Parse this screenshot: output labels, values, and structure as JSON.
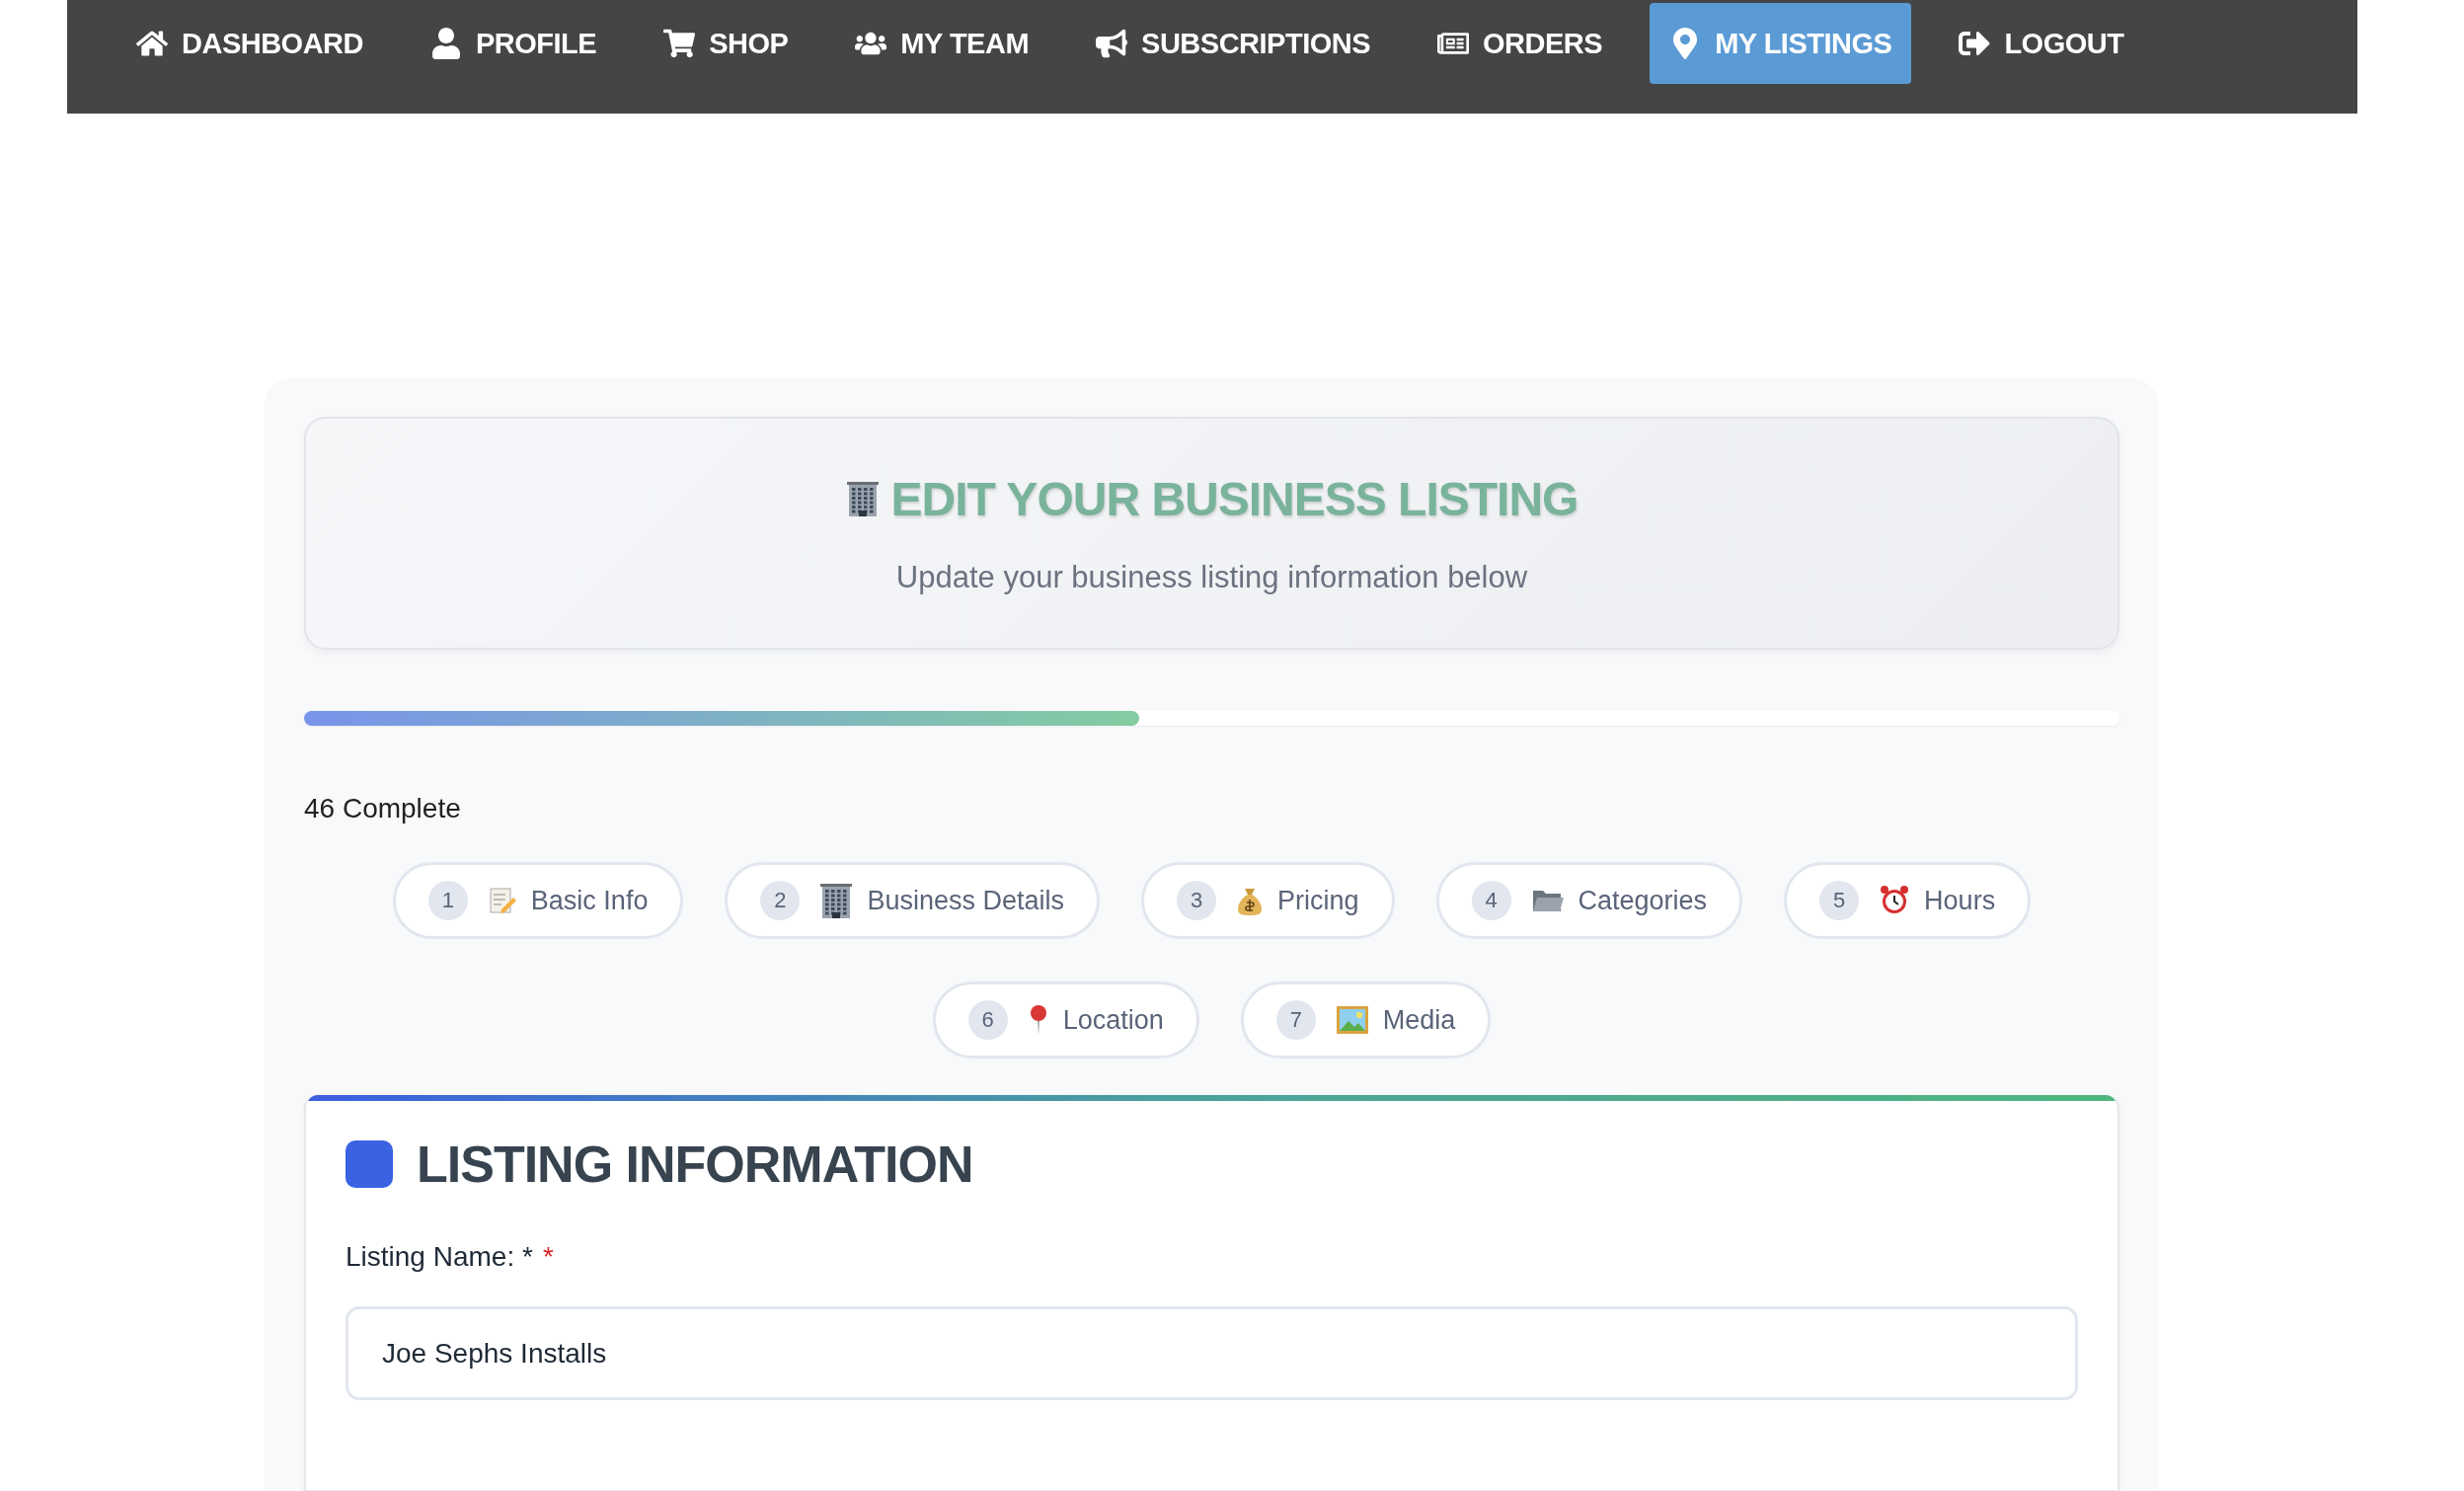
{
  "nav": {
    "items": [
      {
        "label": "DASHBOARD",
        "selected": false
      },
      {
        "label": "PROFILE",
        "selected": false
      },
      {
        "label": "SHOP",
        "selected": false
      },
      {
        "label": "MY TEAM",
        "selected": false
      },
      {
        "label": "SUBSCRIPTIONS",
        "selected": false
      },
      {
        "label": "ORDERS",
        "selected": false
      },
      {
        "label": "MY LISTINGS",
        "selected": true
      },
      {
        "label": "LOGOUT",
        "selected": false
      }
    ]
  },
  "header": {
    "title": "EDIT YOUR BUSINESS LISTING",
    "subtitle": "Update your business listing information below"
  },
  "progress": {
    "level": 0.46,
    "label": "46 Complete"
  },
  "steps": [
    {
      "number": "1",
      "label": "Basic Info"
    },
    {
      "number": "2",
      "label": "Business Details"
    },
    {
      "number": "3",
      "label": "Pricing"
    },
    {
      "number": "4",
      "label": "Categories"
    },
    {
      "number": "5",
      "label": "Hours"
    },
    {
      "number": "6",
      "label": "Location"
    },
    {
      "number": "7",
      "label": "Media"
    }
  ],
  "section": {
    "title": "LISTING INFORMATION",
    "fields": [
      {
        "label": "Listing Name: *",
        "required_mark": "*",
        "value": "Joe Sephs Installs"
      }
    ]
  }
}
